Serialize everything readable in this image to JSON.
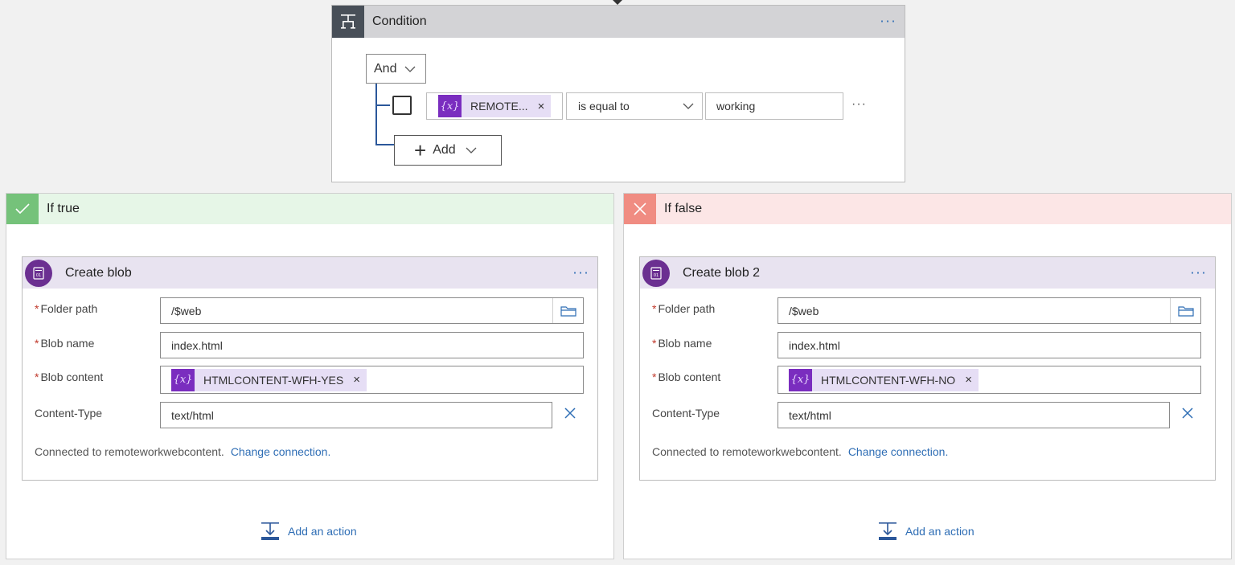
{
  "condition": {
    "title": "Condition",
    "more_label": "···",
    "group_operator": "And",
    "row": {
      "token_label": "REMOTE...",
      "token_icon": "{x}",
      "operator": "is equal to",
      "value": "working",
      "more_label": "···"
    },
    "add_label": "Add"
  },
  "branches": {
    "true": {
      "title": "If true",
      "card": {
        "title": "Create blob",
        "more_label": "···",
        "folder_label": "Folder path",
        "folder_value": "/$web",
        "blob_name_label": "Blob name",
        "blob_name_value": "index.html",
        "blob_content_label": "Blob content",
        "blob_content_token": "HTMLCONTENT-WFH-YES",
        "token_icon": "{x}",
        "content_type_label": "Content-Type",
        "content_type_value": "text/html",
        "connection_text": "Connected to remoteworkwebcontent.",
        "change_connection": "Change connection."
      },
      "add_action": "Add an action"
    },
    "false": {
      "title": "If false",
      "card": {
        "title": "Create blob 2",
        "more_label": "···",
        "folder_label": "Folder path",
        "folder_value": "/$web",
        "blob_name_label": "Blob name",
        "blob_name_value": "index.html",
        "blob_content_label": "Blob content",
        "blob_content_token": "HTMLCONTENT-WFH-NO",
        "token_icon": "{x}",
        "content_type_label": "Content-Type",
        "content_type_value": "text/html",
        "connection_text": "Connected to remoteworkwebcontent.",
        "change_connection": "Change connection."
      },
      "add_action": "Add an action"
    }
  },
  "colors": {
    "accent": "#2f6eb5",
    "condition_header": "#d3d3d6",
    "true_badge": "#75c27a",
    "false_badge": "#f08c82",
    "token_icon_bg": "#7a2dbf",
    "blob_icon_bg": "#6b2f91"
  },
  "icons": [
    "condition-icon",
    "variable-icon",
    "chevron-down-icon",
    "plus-icon",
    "check-icon",
    "close-icon",
    "blob-storage-icon",
    "folder-icon",
    "clear-icon",
    "add-action-icon"
  ]
}
